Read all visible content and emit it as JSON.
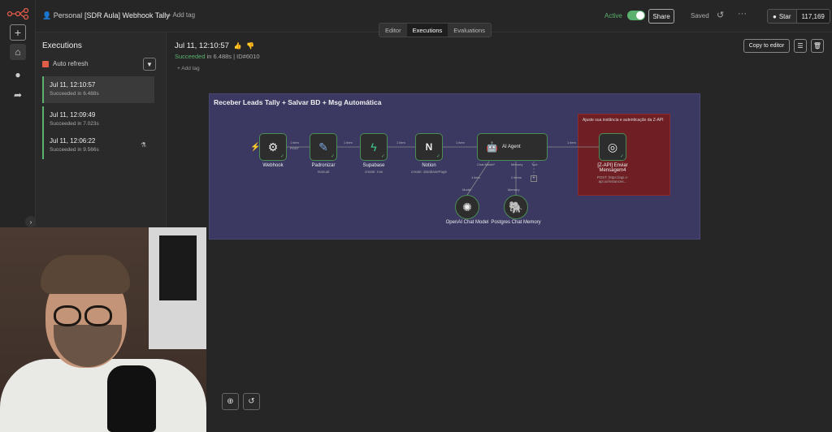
{
  "topbar": {
    "personal": "Personal",
    "workflow_name": "[SDR Aula] Webhook Tally",
    "add_tag": "+ Add tag",
    "active_label": "Active",
    "share_label": "Share",
    "saved_label": "Saved",
    "github_star": "Star",
    "github_count": "117,169"
  },
  "tabs": [
    "Editor",
    "Executions",
    "Evaluations"
  ],
  "executions": {
    "title": "Executions",
    "auto_refresh": "Auto refresh",
    "items": [
      {
        "time": "Jul 11, 12:10:57",
        "status": "Succeeded in 6.488s"
      },
      {
        "time": "Jul 11, 12:09:49",
        "status": "Succeeded in 7.023s"
      },
      {
        "time": "Jul 11, 12:06:22",
        "status": "Succeeded in 9.566s"
      }
    ]
  },
  "detail": {
    "title": "Jul 11, 12:10:57",
    "status": "Succeeded",
    "duration": " in 6.488s | ID#6010",
    "add_tag": "+ Add tag",
    "copy_to_editor": "Copy to editor"
  },
  "workflow": {
    "sticky_title": "Receber Leads Tally + Salvar BD + Msg Automática",
    "red_note": "Ajuste sua instância e autenticação da Z-API",
    "nodes": {
      "webhook": "Webhook",
      "padronizar": "Padronizar",
      "padronizar_sub": "manual",
      "supabase": "Supabase",
      "supabase_sub": "create: row",
      "notion": "Notion",
      "notion_sub": "create: databasePage",
      "agent": "AI Agent",
      "zapi": "[Z-API] Enviar Mensagem4",
      "zapi_sub": "POST: https://api.z-api.io/instances...",
      "openai": "OpenAI Chat Model",
      "postgres": "Postgres Chat Memory"
    },
    "wire_labels": {
      "item1": "1 item",
      "item2": "1 item",
      "item3": "1 item",
      "item4": "1 item",
      "item5": "1 item",
      "item6": "1 item",
      "item_model": "1 item",
      "item_memory": "2 items",
      "chat_model": "Chat Model*",
      "memory": "Memory",
      "tool": "Tool",
      "model": "Model",
      "memory2": "Memory",
      "post": "POST"
    }
  }
}
